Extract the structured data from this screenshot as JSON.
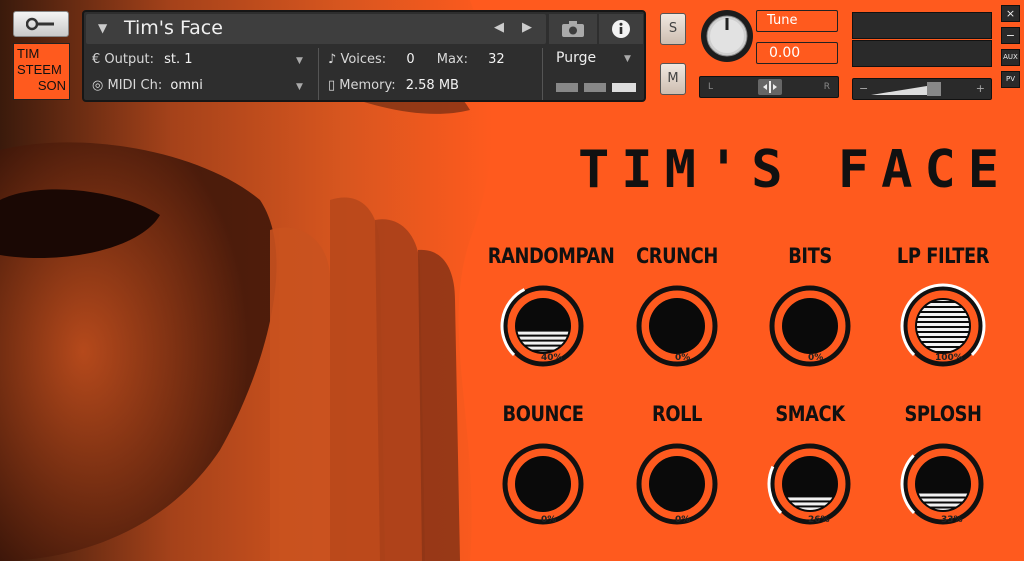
{
  "header": {
    "instrument_title": "Tim's Face",
    "output_label": "Output:",
    "output_value": "st. 1",
    "voices_label": "Voices:",
    "voices_value": "0",
    "max_label": "Max:",
    "max_value": "32",
    "purge_label": "Purge",
    "midi_label": "MIDI Ch:",
    "midi_value": "omni",
    "memory_label": "Memory:",
    "memory_value": "2.58 MB",
    "solo_label": "S",
    "mute_label": "M",
    "tune_label": "Tune",
    "tune_value": "0.00",
    "pan_left": "L",
    "pan_right": "R",
    "vol_minus": "−",
    "vol_plus": "+",
    "side_buttons": [
      "×",
      "−",
      "AUX",
      "PV"
    ]
  },
  "logo": {
    "lines": [
      "TIM",
      "STEEM",
      "SON"
    ]
  },
  "main_title": "TIM'S FACE",
  "knobs": [
    {
      "label": "RANDOMPAN",
      "value_text": "40%",
      "value": 0.4
    },
    {
      "label": "CRUNCH",
      "value_text": "0%",
      "value": 0.0
    },
    {
      "label": "BITS",
      "value_text": "0%",
      "value": 0.0
    },
    {
      "label": "LP FILTER",
      "value_text": "100%",
      "value": 1.0
    },
    {
      "label": "BOUNCE",
      "value_text": "0%",
      "value": 0.0
    },
    {
      "label": "ROLL",
      "value_text": "0%",
      "value": 0.0
    },
    {
      "label": "SMACK",
      "value_text": "26%",
      "value": 0.26
    },
    {
      "label": "SPLOSH",
      "value_text": "33%",
      "value": 0.33
    }
  ],
  "colors": {
    "accent_orange": "#ff5a1e",
    "panel_dark": "#2e2e2e",
    "knob_black": "#0a0a0a"
  }
}
